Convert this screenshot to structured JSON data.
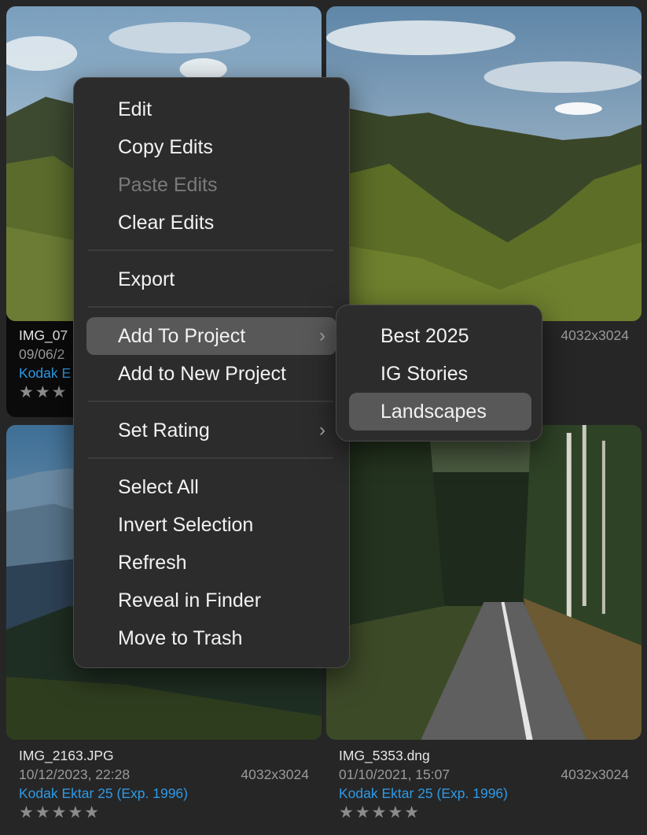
{
  "photos": [
    {
      "filename": "IMG_07",
      "date": "09/06/2",
      "dims": "",
      "recipe": "Kodak E",
      "stars": "★★★"
    },
    {
      "filename": "",
      "date": "",
      "dims": "4032x3024",
      "recipe": "",
      "stars": ""
    },
    {
      "filename": "IMG_2163.JPG",
      "date": "10/12/2023, 22:28",
      "dims": "4032x3024",
      "recipe": "Kodak Ektar 25 (Exp. 1996)",
      "stars": "★★★★★"
    },
    {
      "filename": "IMG_5353.dng",
      "date": "01/10/2021, 15:07",
      "dims": "4032x3024",
      "recipe": "Kodak Ektar 25 (Exp. 1996)",
      "stars": "★★★★★"
    }
  ],
  "context_menu": {
    "items": [
      {
        "label": "Edit",
        "disabled": false
      },
      {
        "label": "Copy Edits",
        "disabled": false
      },
      {
        "label": "Paste Edits",
        "disabled": true
      },
      {
        "label": "Clear Edits",
        "disabled": false
      },
      {
        "label": "Export",
        "disabled": false
      },
      {
        "label": "Add To Project",
        "disabled": false,
        "submenu": true,
        "highlighted": true
      },
      {
        "label": "Add to New Project",
        "disabled": false
      },
      {
        "label": "Set Rating",
        "disabled": false,
        "submenu": true
      },
      {
        "label": "Select All",
        "disabled": false
      },
      {
        "label": "Invert Selection",
        "disabled": false
      },
      {
        "label": "Refresh",
        "disabled": false
      },
      {
        "label": "Reveal in Finder",
        "disabled": false
      },
      {
        "label": "Move to Trash",
        "disabled": false
      }
    ],
    "chevron_icon": "chevron-right-icon"
  },
  "project_submenu": {
    "items": [
      {
        "label": "Best 2025"
      },
      {
        "label": "IG Stories"
      },
      {
        "label": "Landscapes",
        "highlighted": true
      }
    ]
  },
  "colors": {
    "background": "#262626",
    "recipe_link": "#2d9ae6",
    "menu_bg": "#2c2c2c",
    "menu_highlight": "#585858"
  }
}
